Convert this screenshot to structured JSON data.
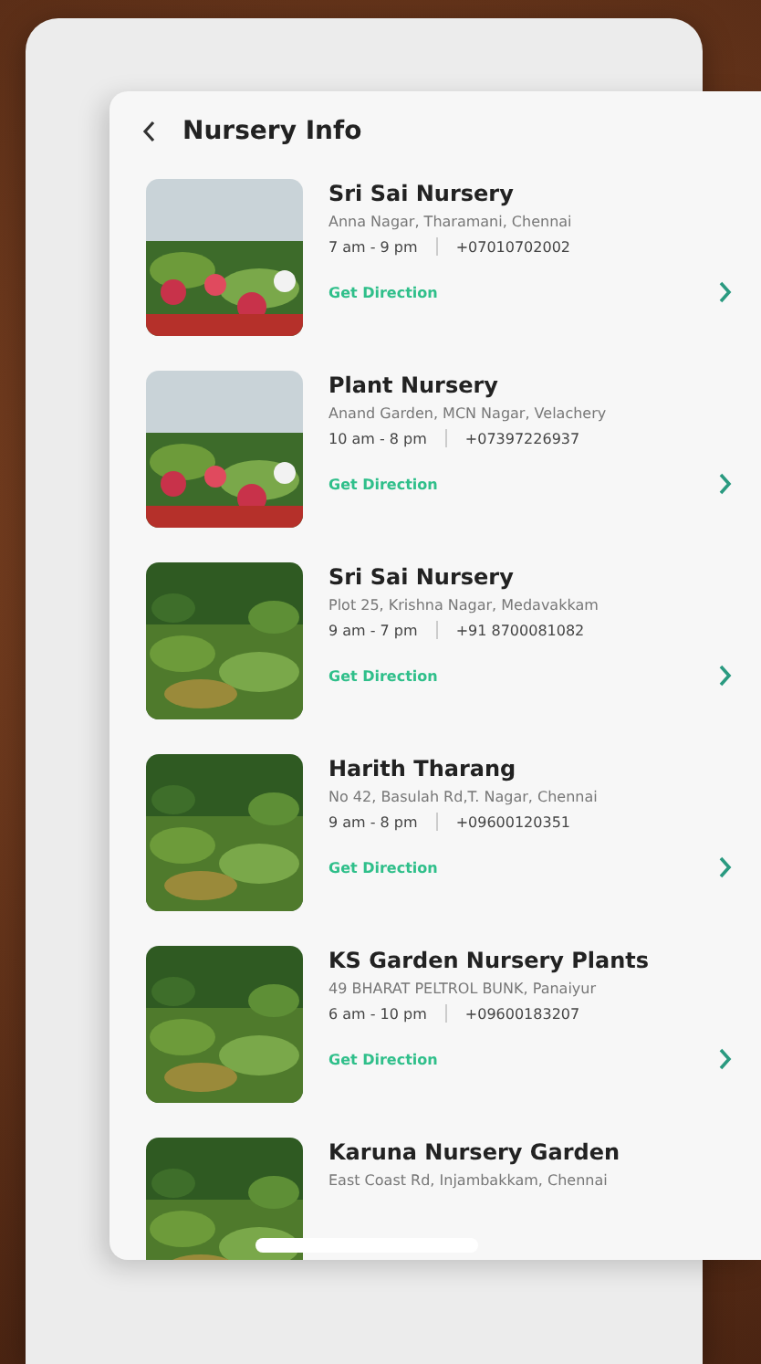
{
  "header": {
    "title": "Nursery Info"
  },
  "nurseries": [
    {
      "name": "Sri Sai Nursery",
      "address": "Anna Nagar, Tharamani, Chennai",
      "hours": "7 am - 9 pm",
      "phone": "+07010702002",
      "action": "Get Direction"
    },
    {
      "name": "Plant Nursery",
      "address": "Anand Garden, MCN Nagar, Velachery",
      "hours": "10 am - 8 pm",
      "phone": "+07397226937",
      "action": "Get Direction"
    },
    {
      "name": "Sri Sai Nursery",
      "address": "Plot 25, Krishna Nagar, Medavakkam",
      "hours": "9 am - 7 pm",
      "phone": "+91 8700081082",
      "action": "Get Direction"
    },
    {
      "name": "Harith Tharang",
      "address": "No 42, Basulah Rd,T. Nagar, Chennai",
      "hours": "9 am - 8 pm",
      "phone": "+09600120351",
      "action": "Get Direction"
    },
    {
      "name": "KS Garden Nursery Plants",
      "address": "49 BHARAT PELTROL BUNK, Panaiyur",
      "hours": "6 am - 10 pm",
      "phone": "+09600183207",
      "action": "Get Direction"
    },
    {
      "name": "Karuna Nursery Garden",
      "address": "East Coast Rd, Injambakkam, Chennai"
    }
  ]
}
